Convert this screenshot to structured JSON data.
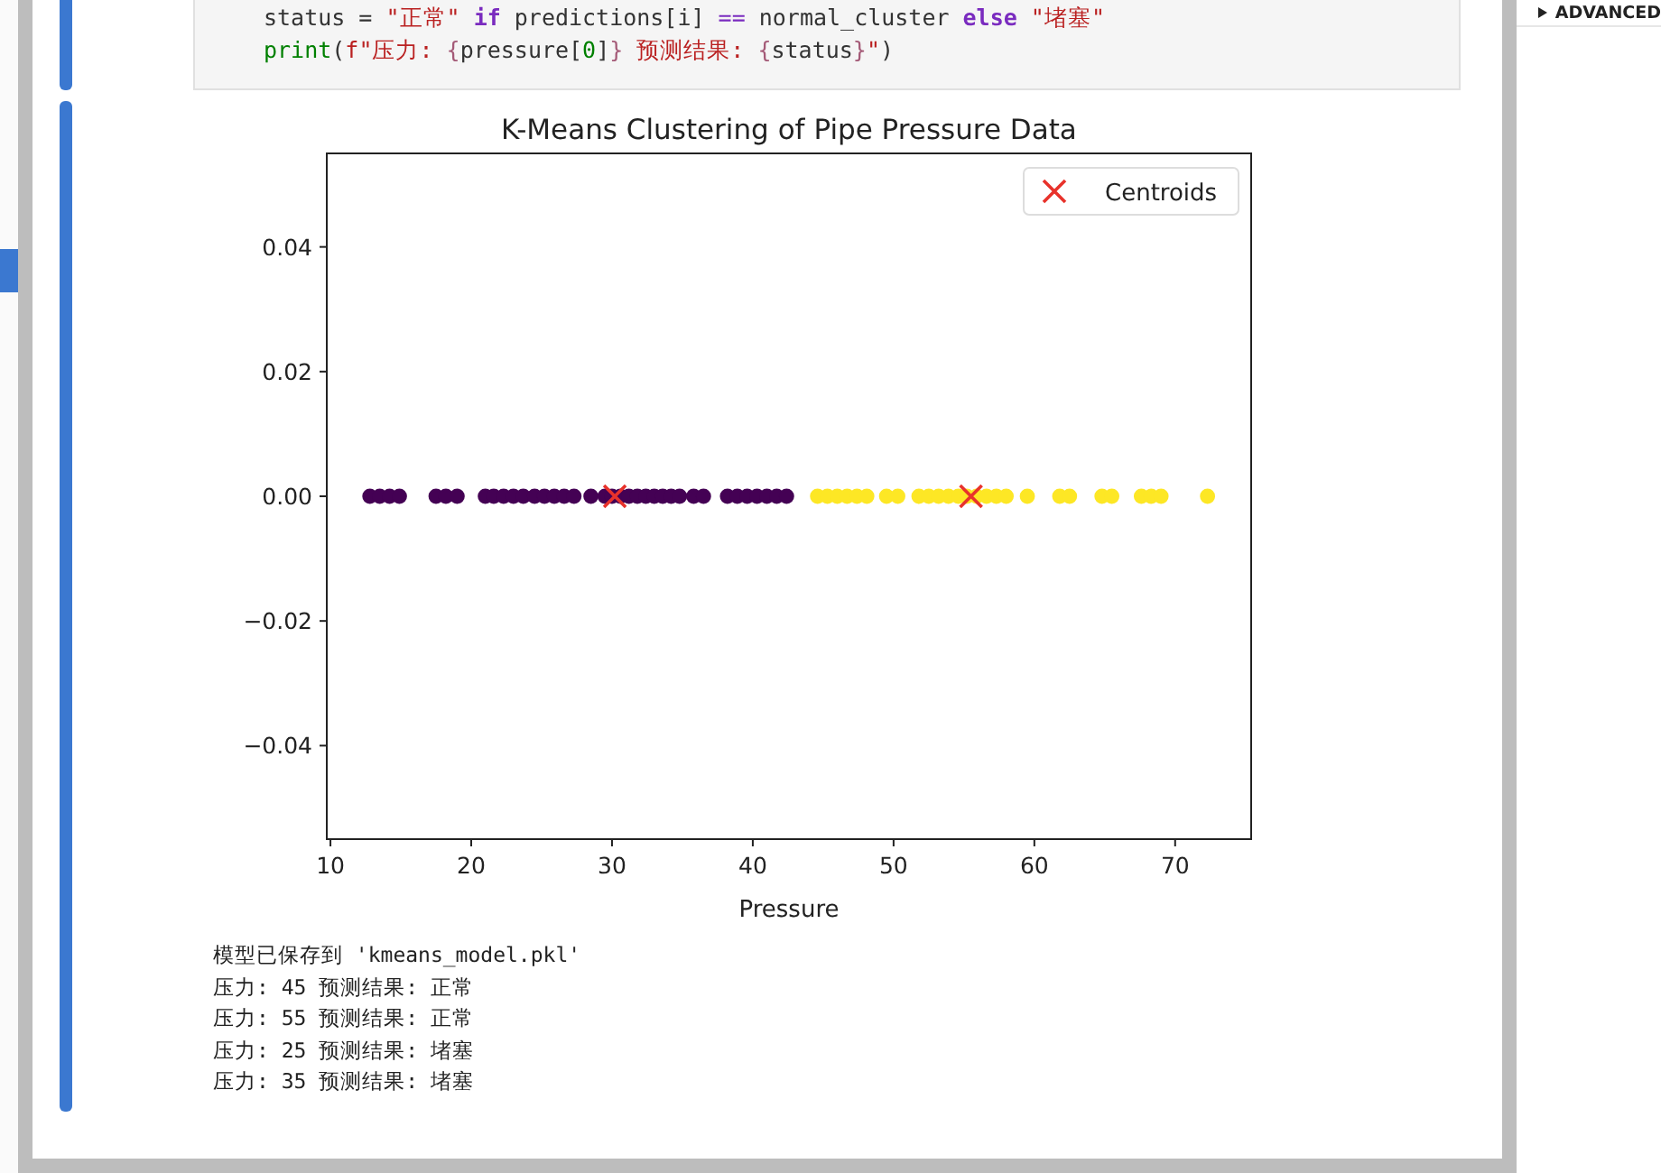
{
  "side_panel": {
    "title": "ADVANCED"
  },
  "code_cell": {
    "lines": [
      [
        {
          "kind": "plain",
          "text": "status = "
        },
        {
          "kind": "string",
          "text": "\"正常\" "
        },
        {
          "kind": "keyword",
          "text": "if"
        },
        {
          "kind": "plain",
          "text": " predictions[i] "
        },
        {
          "kind": "operator",
          "text": "=="
        },
        {
          "kind": "plain",
          "text": " normal_cluster "
        },
        {
          "kind": "keyword",
          "text": "else"
        },
        {
          "kind": "string",
          "text": " \"堵塞\""
        }
      ],
      [
        {
          "kind": "builtin",
          "text": "print"
        },
        {
          "kind": "plain",
          "text": "("
        },
        {
          "kind": "string",
          "text": "f\"压力: "
        },
        {
          "kind": "interp",
          "text": "{"
        },
        {
          "kind": "plain",
          "text": "pressure["
        },
        {
          "kind": "number",
          "text": "0"
        },
        {
          "kind": "plain",
          "text": "]"
        },
        {
          "kind": "interp",
          "text": "}"
        },
        {
          "kind": "string",
          "text": " 预测结果: "
        },
        {
          "kind": "interp",
          "text": "{"
        },
        {
          "kind": "plain",
          "text": "status"
        },
        {
          "kind": "interp",
          "text": "}"
        },
        {
          "kind": "string",
          "text": "\""
        },
        {
          "kind": "plain",
          "text": ")"
        }
      ]
    ]
  },
  "output_cell": {
    "chart_data": {
      "type": "scatter",
      "title": "K-Means Clustering of Pipe Pressure Data",
      "xlabel": "Pressure",
      "xlim": [
        9.74,
        75.4
      ],
      "ylim": [
        -0.055,
        0.055
      ],
      "xticks": [
        10,
        20,
        30,
        40,
        50,
        60,
        70
      ],
      "yticks": [
        {
          "value": 0.04,
          "label": "0.04"
        },
        {
          "value": 0.02,
          "label": "0.02"
        },
        {
          "value": 0,
          "label": "0.00"
        },
        {
          "value": -0.02,
          "label": "−0.02"
        },
        {
          "value": -0.04,
          "label": "−0.04"
        }
      ],
      "series": [
        {
          "color": "#440154",
          "marker": "dot",
          "x": [
            12.8,
            13.5,
            14.2,
            14.9,
            17.5,
            18.2,
            19.0,
            21.0,
            21.6,
            22.3,
            23.0,
            23.7,
            24.5,
            25.2,
            25.9,
            26.6,
            27.3,
            28.5,
            29.5,
            30.0,
            30.6,
            31.2,
            31.8,
            32.4,
            33.0,
            33.6,
            34.2,
            34.8,
            35.8,
            36.5,
            38.2,
            38.9,
            39.6,
            40.3,
            41.0,
            41.7,
            42.4
          ],
          "values": [
            0,
            0,
            0,
            0,
            0,
            0,
            0,
            0,
            0,
            0,
            0,
            0,
            0,
            0,
            0,
            0,
            0,
            0,
            0,
            0,
            0,
            0,
            0,
            0,
            0,
            0,
            0,
            0,
            0,
            0,
            0,
            0,
            0,
            0,
            0,
            0,
            0
          ]
        },
        {
          "color": "#fde725",
          "marker": "dot",
          "x": [
            44.6,
            45.3,
            46.0,
            46.7,
            47.4,
            48.1,
            49.5,
            50.3,
            51.8,
            52.5,
            53.2,
            53.9,
            54.6,
            55.2,
            55.9,
            56.6,
            57.3,
            58.0,
            59.5,
            61.8,
            62.5,
            64.8,
            65.5,
            67.6,
            68.3,
            69.0,
            72.3
          ],
          "values": [
            0,
            0,
            0,
            0,
            0,
            0,
            0,
            0,
            0,
            0,
            0,
            0,
            0,
            0,
            0,
            0,
            0,
            0,
            0,
            0,
            0,
            0,
            0,
            0,
            0,
            0,
            0
          ]
        },
        {
          "name": "Centroids",
          "color": "#e8322b",
          "marker": "cross",
          "x": [
            30.2,
            55.5
          ],
          "values": [
            0,
            0
          ]
        }
      ]
    },
    "text_output": [
      "模型已保存到 'kmeans_model.pkl'",
      "压力: 45 预测结果: 正常",
      "压力: 55 预测结果: 正常",
      "压力: 25 预测结果: 堵塞",
      "压力: 35 预测结果: 堵塞"
    ]
  }
}
